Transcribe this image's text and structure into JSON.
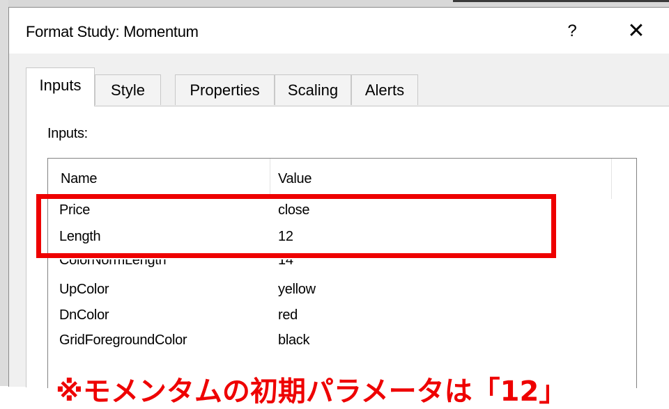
{
  "dialog": {
    "title": "Format Study: Momentum",
    "help_label": "?",
    "close_label": "✕"
  },
  "tabs": [
    {
      "label": "Inputs",
      "active": true
    },
    {
      "label": "Style",
      "active": false
    },
    {
      "label": "Properties",
      "active": false
    },
    {
      "label": "Scaling",
      "active": false
    },
    {
      "label": "Alerts",
      "active": false
    }
  ],
  "panel": {
    "caption": "Inputs:",
    "columns": {
      "name": "Name",
      "value": "Value"
    },
    "rows": [
      {
        "name": "Price",
        "value": "close"
      },
      {
        "name": "Length",
        "value": "12"
      },
      {
        "name": "ColorNormLength",
        "value": "14"
      },
      {
        "name": "UpColor",
        "value": "yellow"
      },
      {
        "name": "DnColor",
        "value": "red"
      },
      {
        "name": "GridForegroundColor",
        "value": "black"
      }
    ]
  },
  "annotation": {
    "color": "#ee0000",
    "note": "※モメンタムの初期パラメータは「12」"
  }
}
